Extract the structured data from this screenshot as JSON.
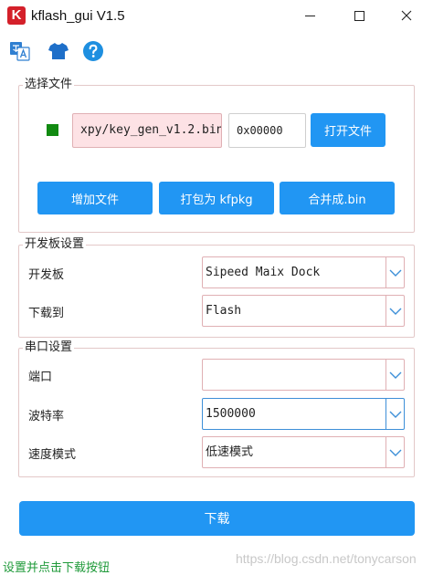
{
  "window": {
    "title": "kflash_gui V1.5",
    "logo_letter": "K",
    "logo_color": "#d4202a",
    "icons": [
      "minimize-icon",
      "maximize-icon",
      "close-icon"
    ]
  },
  "toolbar": {
    "icons": [
      "translate-icon",
      "tshirt-icon",
      "help-icon"
    ],
    "accent": "#2196f3"
  },
  "file_section": {
    "title": "选择文件",
    "file_path": "xpy/key_gen_v1.2.bin",
    "address": "0x00000",
    "open_label": "打开文件",
    "add_label": "增加文件",
    "pack_label": "打包为 kfpkg",
    "merge_label": "合并成.bin",
    "status_color": "#118a11"
  },
  "board_section": {
    "title": "开发板设置",
    "board_label": "开发板",
    "board_value": "Sipeed Maix Dock",
    "target_label": "下载到",
    "target_value": "Flash"
  },
  "serial_section": {
    "title": "串口设置",
    "port_label": "端口",
    "port_value": "",
    "baud_label": "波特率",
    "baud_value": "1500000",
    "speed_label": "速度模式",
    "speed_value": "低速模式"
  },
  "download_label": "下载",
  "status_text": "设置并点击下载按钮",
  "watermark": "https://blog.csdn.net/tonycarson"
}
